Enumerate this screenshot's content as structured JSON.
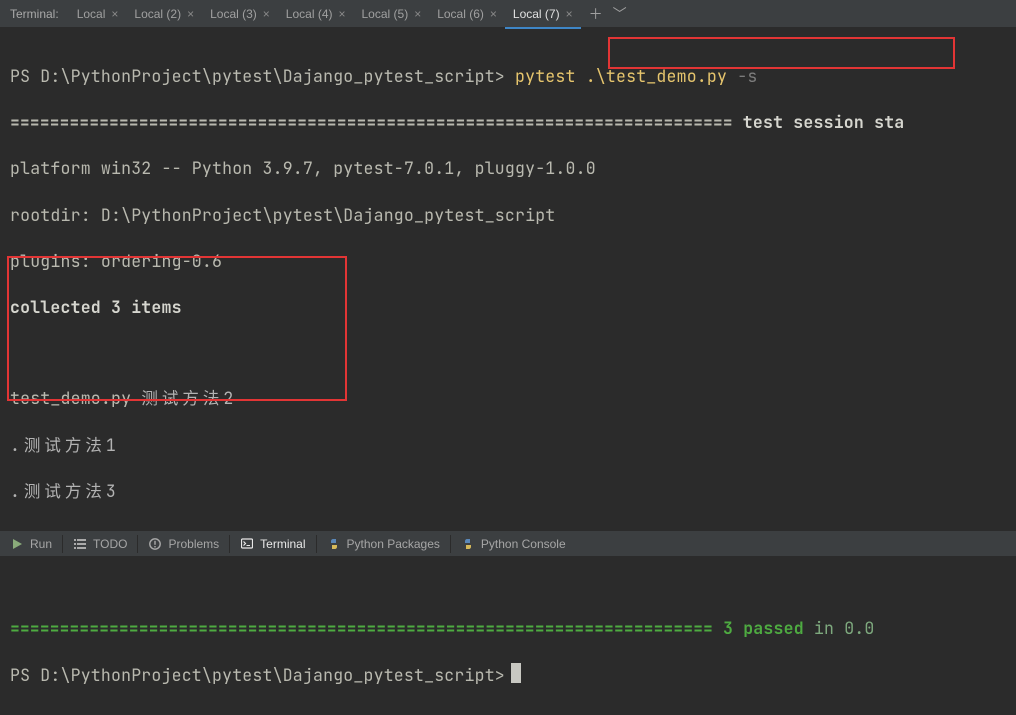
{
  "tabs": {
    "label": "Terminal:",
    "items": [
      {
        "label": "Local"
      },
      {
        "label": "Local (2)"
      },
      {
        "label": "Local (3)"
      },
      {
        "label": "Local (4)"
      },
      {
        "label": "Local (5)"
      },
      {
        "label": "Local (6)"
      },
      {
        "label": "Local (7)"
      }
    ],
    "active_index": 6
  },
  "terminal": {
    "prompt": "PS D:\\PythonProject\\pytest\\Dajango_pytest_script> ",
    "cmd": "pytest .\\test_demo.py",
    "flag": "-s",
    "session_hdr_right": " test session sta",
    "line_platform": "platform win32 -- Python 3.9.7, pytest-7.0.1, pluggy-1.0.0",
    "line_rootdir": "rootdir: D:\\PythonProject\\pytest\\Dajango_pytest_script",
    "line_plugins": "plugins: ordering-0.6",
    "line_collected": "collected 3 items",
    "out_file": "test_demo.py ",
    "out_line1": "测试方法2",
    "out_line2": ".测试方法1",
    "out_line3": ".测试方法3",
    "out_dot": ".",
    "result_green": " 3 passed ",
    "result_tail": "in 0.0",
    "prompt2": "PS D:\\PythonProject\\pytest\\Dajango_pytest_script>"
  },
  "bottom": {
    "run": "Run",
    "todo": "TODO",
    "problems": "Problems",
    "terminal": "Terminal",
    "packages": "Python Packages",
    "console": "Python Console"
  },
  "eq_long": "=========================================================================",
  "eq_short": "======================================================================="
}
